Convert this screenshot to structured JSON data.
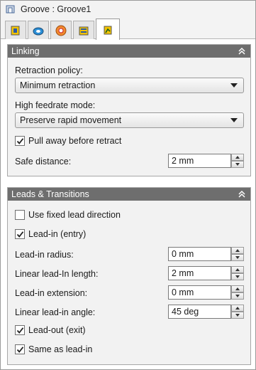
{
  "window": {
    "title": "Groove : Groove1"
  },
  "tabs": [
    {
      "icon": "tool-icon"
    },
    {
      "icon": "geometry-icon"
    },
    {
      "icon": "heights-icon"
    },
    {
      "icon": "passes-icon"
    },
    {
      "icon": "linking-icon",
      "active": true
    }
  ],
  "linking": {
    "header": "Linking",
    "retraction_policy_label": "Retraction policy:",
    "retraction_policy_value": "Minimum retraction",
    "high_feedrate_label": "High feedrate mode:",
    "high_feedrate_value": "Preserve rapid movement",
    "pull_away_label": "Pull away before retract",
    "pull_away_checked": true,
    "safe_distance_label": "Safe distance:",
    "safe_distance_value": "2 mm"
  },
  "leads": {
    "header": "Leads & Transitions",
    "fixed_lead_label": "Use fixed lead direction",
    "fixed_lead_checked": false,
    "lead_in_label": "Lead-in (entry)",
    "lead_in_checked": true,
    "lead_in_radius_label": "Lead-in radius:",
    "lead_in_radius_value": "0 mm",
    "linear_lead_in_length_label": "Linear lead-In length:",
    "linear_lead_in_length_value": "2 mm",
    "lead_in_extension_label": "Lead-in extension:",
    "lead_in_extension_value": "0 mm",
    "linear_lead_in_angle_label": "Linear lead-in angle:",
    "linear_lead_in_angle_value": "45 deg",
    "lead_out_label": "Lead-out (exit)",
    "lead_out_checked": true,
    "same_as_lead_in_label": "Same as lead-in",
    "same_as_lead_in_checked": true
  },
  "colors": {
    "group_header_bg": "#6e6e6e",
    "panel_bg": "#f2f2f2"
  }
}
